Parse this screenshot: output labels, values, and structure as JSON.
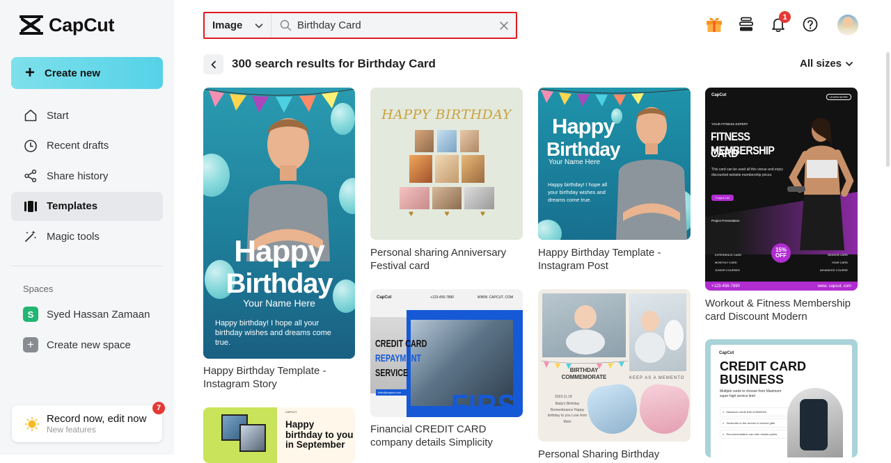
{
  "app": {
    "name": "CapCut"
  },
  "sidebar": {
    "create_new": "Create new",
    "items": [
      {
        "label": "Start",
        "icon": "home-icon"
      },
      {
        "label": "Recent drafts",
        "icon": "clock-icon"
      },
      {
        "label": "Share history",
        "icon": "share-icon"
      },
      {
        "label": "Templates",
        "icon": "templates-icon",
        "active": true
      },
      {
        "label": "Magic tools",
        "icon": "magic-wand-icon"
      }
    ],
    "spaces_label": "Spaces",
    "space_name": "Syed Hassan Zamaan",
    "space_initial": "S",
    "create_space": "Create new space",
    "record": {
      "title": "Record now, edit now",
      "subtitle": "New features",
      "badge": "7"
    }
  },
  "search": {
    "type": "Image",
    "query": "Birthday Card"
  },
  "topbar": {
    "notifications_count": "1"
  },
  "results": {
    "title": "300 search results for Birthday Card",
    "sizes": "All sizes"
  },
  "cards": [
    {
      "caption": "Happy Birthday Template - Instagram Story",
      "title1": "Happy",
      "title2": "Birthday",
      "name": "Your Name Here",
      "body": "Happy birthday! I hope all your birthday wishes and dreams come true."
    },
    {
      "caption": "Personal sharing Anniversary Festival card",
      "title": "HAPPY BIRTHDAY"
    },
    {
      "caption": "Happy Birthday Template - Instagram Post",
      "title1": "Happy",
      "title2": "Birthday",
      "name": "Your Name Here",
      "body": "Happy birthday! I hope all your birthday wishes and dreams come true."
    },
    {
      "caption": "Workout & Fitness Membership card Discount Modern",
      "brand": "CapCut",
      "learn": "LEARN MORE",
      "expert": "YOUR FITNESS EXPERT",
      "title1": "FITNESS MEMBERSHIP",
      "title2": "CARD",
      "body": "This card can be used all this venue and enjoy discounted website membership prices.",
      "cta": "Project List",
      "present": "Project Presentation",
      "discount1": "15%",
      "discount2": "OFF",
      "left_list": [
        "EXPERIENCE CARD",
        "MONTHLY CARD",
        "JUNIOR COURSES"
      ],
      "right_list": [
        "SEASON CARD",
        "YEAR CARD",
        "ADVANCED COURSE"
      ],
      "phone": "+123-456-7890",
      "site": "www. capcut. com"
    },
    {
      "caption": "Financial CREDIT CARD company details Simplicity",
      "brand": "CapCut",
      "phone": "+123-456-7890",
      "site": "WWW. CAPCUT. COM",
      "t1": "CREDIT CARD",
      "t2": "REPAYMENT",
      "t3": "SERVICE",
      "email": "hello@capcut.com",
      "big": "FIRST"
    },
    {
      "caption": "Personal Sharing Birthday",
      "label1": "BIRTHDAY",
      "label2": "COMMEMORATE",
      "keep": "KEEP AS A MEMENTO",
      "date": "2023.11.18",
      "body": "Baby's Birthday Remembrance Happy birthday to you Love from Mom"
    },
    {
      "caption": "",
      "brand": "CAPCUT",
      "title": "Happy birthday to you in September"
    },
    {
      "caption": "",
      "brand": "CapCut",
      "title1": "CREDIT CARD",
      "title2": "BUSINESS",
      "body": "Multiple cards to choose from Maximum super high service limit",
      "f1": "Maximum credit limit of $500000",
      "f2": "Subscribe to the service to receive gifts",
      "f3": "Recommendation can earn double points"
    }
  ],
  "colors": {
    "accent": "#55d2e8",
    "alert": "#e53935",
    "highlight_border": "#e0191e"
  }
}
